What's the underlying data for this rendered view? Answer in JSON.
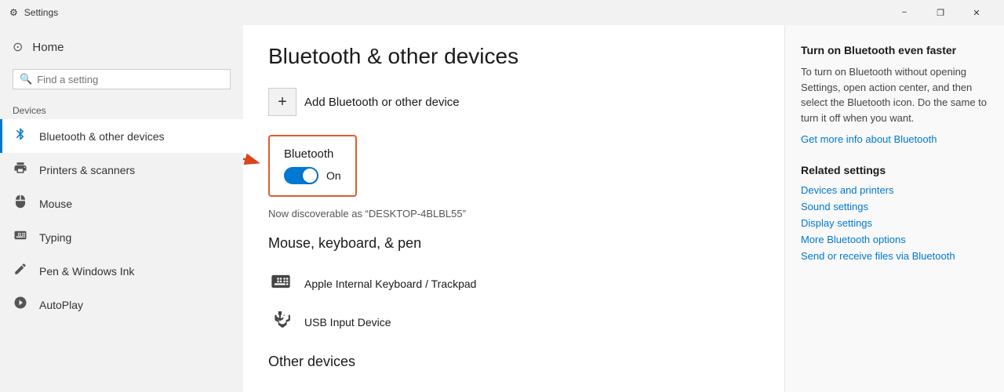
{
  "titleBar": {
    "appName": "Settings",
    "minimizeLabel": "−",
    "restoreLabel": "❐",
    "closeLabel": "✕"
  },
  "sidebar": {
    "homeLabel": "Home",
    "searchPlaceholder": "Find a setting",
    "sectionLabel": "Devices",
    "items": [
      {
        "id": "bluetooth",
        "label": "Bluetooth & other devices",
        "icon": "📶",
        "active": true
      },
      {
        "id": "printers",
        "label": "Printers & scanners",
        "icon": "🖨",
        "active": false
      },
      {
        "id": "mouse",
        "label": "Mouse",
        "icon": "🖱",
        "active": false
      },
      {
        "id": "typing",
        "label": "Typing",
        "icon": "⌨",
        "active": false
      },
      {
        "id": "pen",
        "label": "Pen & Windows Ink",
        "icon": "✏",
        "active": false
      },
      {
        "id": "autoplay",
        "label": "AutoPlay",
        "icon": "▶",
        "active": false
      }
    ]
  },
  "main": {
    "pageTitle": "Bluetooth & other devices",
    "addDeviceLabel": "Add Bluetooth or other device",
    "bluetoothLabel": "Bluetooth",
    "toggleState": "On",
    "discoverableText": "Now discoverable as “DESKTOP-4BLBL55”",
    "mouseKeyboardHeading": "Mouse, keyboard, & pen",
    "devices": [
      {
        "id": "keyboard",
        "label": "Apple Internal Keyboard / Trackpad",
        "icon": "⌨"
      },
      {
        "id": "usb",
        "label": "USB Input Device",
        "icon": "✱"
      }
    ],
    "otherDevicesHeading": "Other devices"
  },
  "rightPanel": {
    "fasterTitle": "Turn on Bluetooth even faster",
    "fasterDescription": "To turn on Bluetooth without opening Settings, open action center, and then select the Bluetooth icon. Do the same to turn it off when you want.",
    "moreInfoLink": "Get more info about Bluetooth",
    "relatedSettingsTitle": "Related settings",
    "relatedLinks": [
      "Devices and printers",
      "Sound settings",
      "Display settings",
      "More Bluetooth options",
      "Send or receive files via Bluetooth"
    ]
  }
}
